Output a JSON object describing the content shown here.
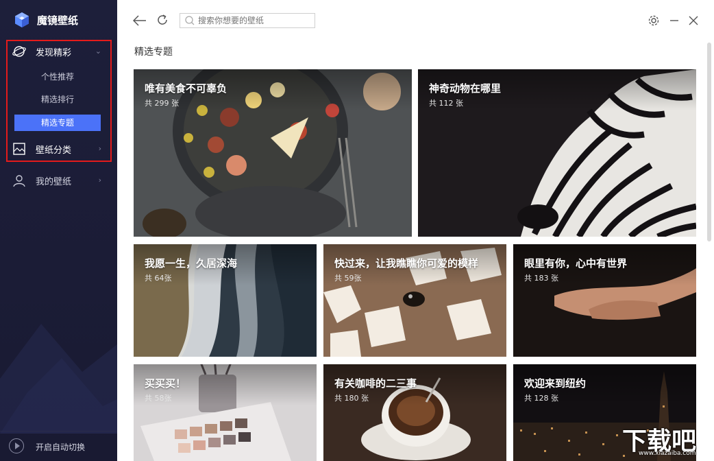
{
  "app": {
    "title": "魔镜壁纸"
  },
  "sidebar": {
    "discover": {
      "label": "发现精彩",
      "items": [
        "个性推荐",
        "精选排行",
        "精选专题"
      ],
      "active": "精选专题"
    },
    "category": {
      "label": "壁纸分类"
    },
    "mine": {
      "label": "我的壁纸"
    },
    "auto_switch": {
      "label": "开启自动切换"
    }
  },
  "header": {
    "search_placeholder": "搜索你想要的壁纸"
  },
  "main": {
    "section_title": "精选专题",
    "cards": [
      {
        "title": "唯有美食不可辜负",
        "count": "共 299 张"
      },
      {
        "title": "神奇动物在哪里",
        "count": "共 112 张"
      },
      {
        "title": "我愿一生，久居深海",
        "count": "共 64张"
      },
      {
        "title": "快过来，让我瞧瞧你可爱的模样",
        "count": "共 59张"
      },
      {
        "title": "眼里有你，心中有世界",
        "count": "共 183 张"
      },
      {
        "title": "买买买！",
        "count": "共 58张"
      },
      {
        "title": "有关咖啡的二三事",
        "count": "共 180 张"
      },
      {
        "title": "欢迎来到纽约",
        "count": "共 128 张"
      }
    ]
  },
  "watermark": {
    "brand": "下载吧",
    "url": "www.xiazaiba.com"
  },
  "colors": {
    "sidebar_bg": "#1d1f3a",
    "accent": "#4b72f8",
    "highlight": "#e51b1b"
  },
  "icons": [
    "logo-icon",
    "discover-icon",
    "category-icon",
    "user-icon",
    "back-arrow-icon",
    "refresh-icon",
    "search-icon",
    "settings-icon",
    "minimize-icon",
    "close-icon",
    "play-icon"
  ]
}
